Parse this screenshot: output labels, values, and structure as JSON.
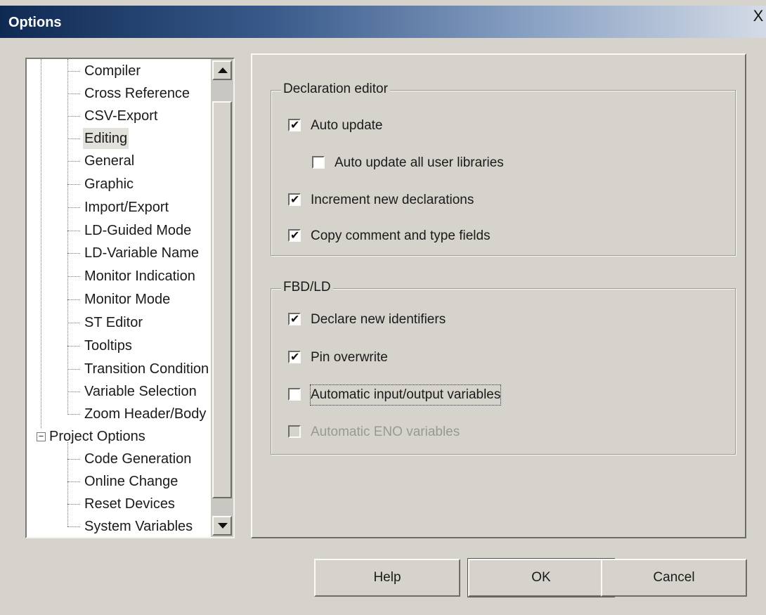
{
  "window": {
    "title": "Options",
    "close_label": "X"
  },
  "tree": {
    "environment_items": [
      {
        "label": "Compiler"
      },
      {
        "label": "Cross Reference"
      },
      {
        "label": "CSV-Export"
      },
      {
        "label": "Editing",
        "selected": true
      },
      {
        "label": "General"
      },
      {
        "label": "Graphic"
      },
      {
        "label": "Import/Export"
      },
      {
        "label": "LD-Guided Mode"
      },
      {
        "label": "LD-Variable Name"
      },
      {
        "label": "Monitor Indication"
      },
      {
        "label": "Monitor Mode"
      },
      {
        "label": "ST Editor"
      },
      {
        "label": "Tooltips"
      },
      {
        "label": "Transition Condition"
      },
      {
        "label": "Variable Selection"
      },
      {
        "label": "Zoom Header/Body"
      }
    ],
    "project_root": {
      "label": "Project Options",
      "expander": "−"
    },
    "project_items": [
      {
        "label": "Code Generation"
      },
      {
        "label": "Online Change"
      },
      {
        "label": "Reset Devices"
      },
      {
        "label": "System Variables"
      }
    ]
  },
  "declaration_editor": {
    "legend": "Declaration editor",
    "options": [
      {
        "label": "Auto update",
        "checked": true
      },
      {
        "label": "Auto update all user libraries",
        "checked": false
      },
      {
        "label": "Increment new declarations",
        "checked": true
      },
      {
        "label": "Copy comment and type fields",
        "checked": true
      }
    ]
  },
  "fbd_ld": {
    "legend": "FBD/LD",
    "options": [
      {
        "label": "Declare new identifiers",
        "checked": true
      },
      {
        "label": "Pin overwrite",
        "checked": true
      },
      {
        "label": "Automatic input/output variables",
        "checked": false,
        "focus": true
      },
      {
        "label": "Automatic ENO variables",
        "checked": false,
        "disabled": true
      }
    ]
  },
  "buttons": {
    "help": "Help",
    "ok": "OK",
    "cancel": "Cancel"
  }
}
